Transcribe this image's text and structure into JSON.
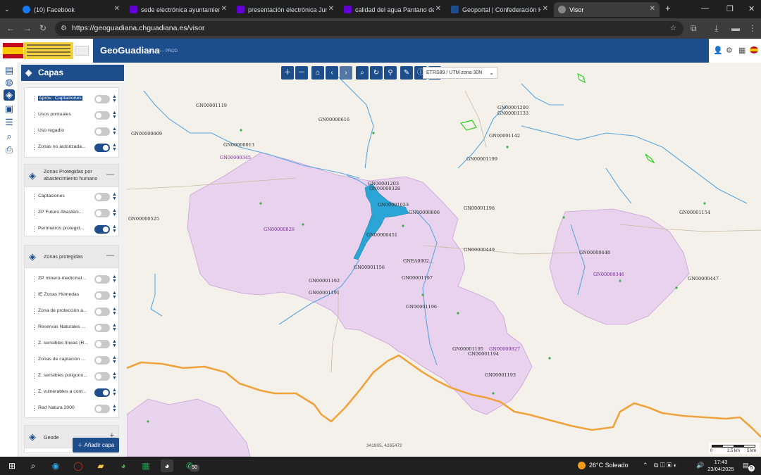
{
  "browser": {
    "tabs": [
      {
        "label": "(10) Facebook",
        "icon": "facebook-icon",
        "color": "#1877f2",
        "active": false
      },
      {
        "label": "sede electrónica ayuntamiento",
        "icon": "yahoo-icon",
        "color": "#6001d2",
        "active": false
      },
      {
        "label": "presentación electrónica Junta",
        "icon": "yahoo-icon",
        "color": "#6001d2",
        "active": false
      },
      {
        "label": "calidad del agua Pantano de La",
        "icon": "yahoo-icon",
        "color": "#6001d2",
        "active": false
      },
      {
        "label": "Geoportal | Confederación Hid",
        "icon": "chg-icon",
        "color": "#1e4d8c",
        "active": false
      },
      {
        "label": "Visor",
        "icon": "globe-icon",
        "color": "#888888",
        "active": true
      }
    ],
    "new_tab": "+",
    "url": "https://geoguadiana.chguadiana.es/visor"
  },
  "app": {
    "name": "GeoGuadiana",
    "version": "v 0.6.5 – PROD",
    "brand_color": "#1e4d8c"
  },
  "rail": [
    {
      "icon": "map-icon",
      "active": false
    },
    {
      "icon": "globe-icon",
      "active": false
    },
    {
      "icon": "layers-icon",
      "active": true
    },
    {
      "icon": "legend-icon",
      "active": false
    },
    {
      "icon": "notes-icon",
      "active": false
    },
    {
      "icon": "search-icon",
      "active": false
    },
    {
      "icon": "print-icon",
      "active": false
    }
  ],
  "panel": {
    "title": "Capas",
    "add_button": "Añadir capa",
    "groups": [
      {
        "title": "",
        "collapse_symbol": "",
        "layers": [
          {
            "name": "Aprov.: Captaciones",
            "on": false,
            "selected": true
          },
          {
            "name": "Usos puntuales",
            "on": false
          },
          {
            "name": "Uso regadío",
            "on": false
          },
          {
            "name": "Zonas no autorizada...",
            "on": true
          }
        ]
      },
      {
        "title": "Zonas Protegidas por abastecimiento humano",
        "collapse_symbol": "—",
        "layers": [
          {
            "name": "Captaciones",
            "on": false
          },
          {
            "name": "ZP Futuro Abasteci...",
            "on": false
          },
          {
            "name": "Perímetros protegid...",
            "on": true
          }
        ]
      },
      {
        "title": "Zonas protegidas",
        "collapse_symbol": "—",
        "layers": [
          {
            "name": "ZP minero-medicinal...",
            "on": false
          },
          {
            "name": "IE Zonas Húmedas",
            "on": false
          },
          {
            "name": "Zona de protección a...",
            "on": false
          },
          {
            "name": "Reservas Naturales ...",
            "on": false
          },
          {
            "name": "Z. sensibles líneas (R...",
            "on": false
          },
          {
            "name": "Zonas de captación ...",
            "on": false
          },
          {
            "name": "Z. sensibles polígono...",
            "on": false
          },
          {
            "name": "Z. vulnerables a cont...",
            "on": true
          },
          {
            "name": "Red Natura 2000",
            "on": false
          }
        ]
      },
      {
        "title": "Geode",
        "collapse_symbol": "+",
        "layers": []
      }
    ]
  },
  "map": {
    "crs": "ETRS89 / UTM zona 30N",
    "coordinates": "341905, 4265472",
    "scale_labels": [
      "0",
      "2.5 km",
      "5 km"
    ],
    "tools": [
      "zoom-in-icon",
      "zoom-out-icon",
      "home-icon",
      "back-icon",
      "forward-icon",
      "zoom-box-icon",
      "refresh-icon",
      "pin-icon",
      "measure-icon",
      "info-icon",
      "globe-icon"
    ],
    "labels": [
      {
        "text": "GN00001119",
        "purple": false
      },
      {
        "text": "GN00000609",
        "purple": false
      },
      {
        "text": "GN00000616",
        "purple": false
      },
      {
        "text": "GN00000013",
        "purple": false
      },
      {
        "text": "GN00000345",
        "purple": true
      },
      {
        "text": "GN00001200",
        "purple": false
      },
      {
        "text": "GN00001133",
        "purple": false
      },
      {
        "text": "GN00001142",
        "purple": false
      },
      {
        "text": "GN00001199",
        "purple": false
      },
      {
        "text": "GN00001203",
        "purple": false
      },
      {
        "text": "GN00000328",
        "purple": false
      },
      {
        "text": "GN00001023",
        "purple": false
      },
      {
        "text": "GN00000806",
        "purple": false
      },
      {
        "text": "GN00001198",
        "purple": false
      },
      {
        "text": "GN00000525",
        "purple": false
      },
      {
        "text": "GN00000826",
        "purple": true
      },
      {
        "text": "GN00000451",
        "purple": false
      },
      {
        "text": "GN00000449",
        "purple": false
      },
      {
        "text": "GNEA0002…",
        "purple": false
      },
      {
        "text": "GN00001156",
        "purple": false
      },
      {
        "text": "GN00001197",
        "purple": false
      },
      {
        "text": "GN00001192",
        "purple": false
      },
      {
        "text": "GN00001191",
        "purple": false
      },
      {
        "text": "GN00001196",
        "purple": false
      },
      {
        "text": "GN00000448",
        "purple": false
      },
      {
        "text": "GN00000346",
        "purple": true
      },
      {
        "text": "GN00000447",
        "purple": false
      },
      {
        "text": "GN00001154",
        "purple": false
      },
      {
        "text": "GN00001195",
        "purple": false
      },
      {
        "text": "GN00000827",
        "purple": true
      },
      {
        "text": "GN00001194",
        "purple": false
      },
      {
        "text": "GN00001193",
        "purple": false
      }
    ]
  },
  "taskbar": {
    "weather": "26°C Soleado",
    "time": "17:43",
    "date": "23/04/2025",
    "badge": "50",
    "notif": "5"
  }
}
